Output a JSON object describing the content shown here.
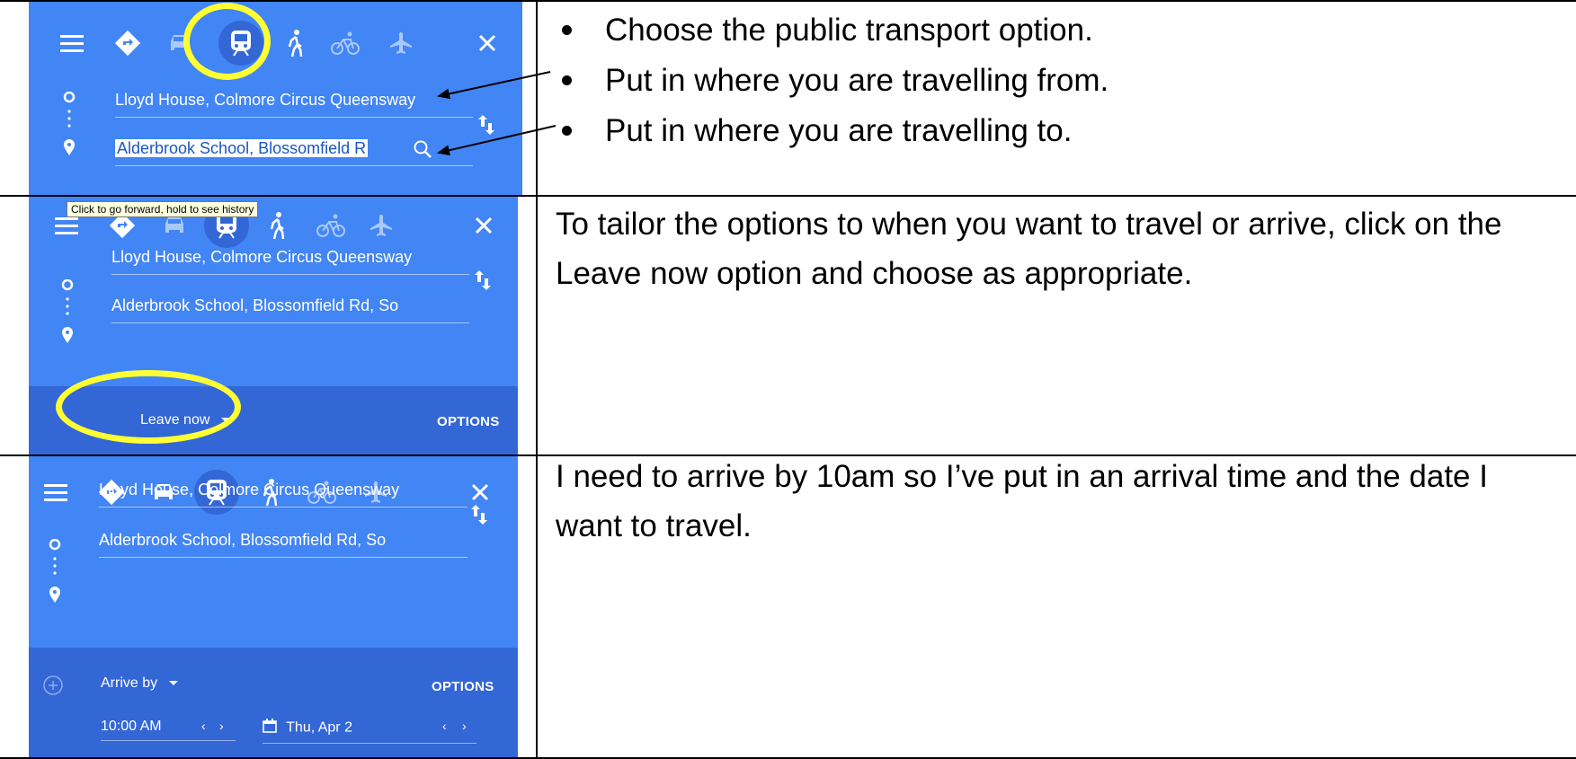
{
  "step1": {
    "from": "Lloyd House, Colmore Circus Queensway",
    "to": "Alderbrook School, Blossomfield R",
    "bullets": [
      "Choose the public transport option.",
      "Put in where you are travelling from.",
      "Put in where you are travelling to."
    ]
  },
  "step2": {
    "tooltip": "Click to go forward, hold to see history",
    "from": "Lloyd House, Colmore Circus Queensway",
    "to": "Alderbrook School, Blossomfield Rd, So",
    "leave": "Leave now",
    "options": "OPTIONS",
    "instruction": "To tailor the options to when you want to travel or arrive, click on the Leave now option and choose as appropriate."
  },
  "step3": {
    "from": "Lloyd House, Colmore Circus Queensway",
    "to": "Alderbrook School, Blossomfield Rd, So",
    "arrive": "Arrive by",
    "options": "OPTIONS",
    "time": "10:00 AM",
    "date": "Thu, Apr 2",
    "instruction": "I need to arrive by 10am so I’ve put in an arrival time and the date I want to travel."
  },
  "colors": {
    "panel": "#4285f4",
    "panel_dark": "#3367d6",
    "highlight": "#ffff33"
  },
  "icons": [
    "menu-icon",
    "directions-icon",
    "car-icon",
    "transit-icon",
    "walk-icon",
    "bicycle-icon",
    "flight-icon",
    "close-icon",
    "swap-icon",
    "search-icon",
    "calendar-icon",
    "add-circle-icon"
  ]
}
